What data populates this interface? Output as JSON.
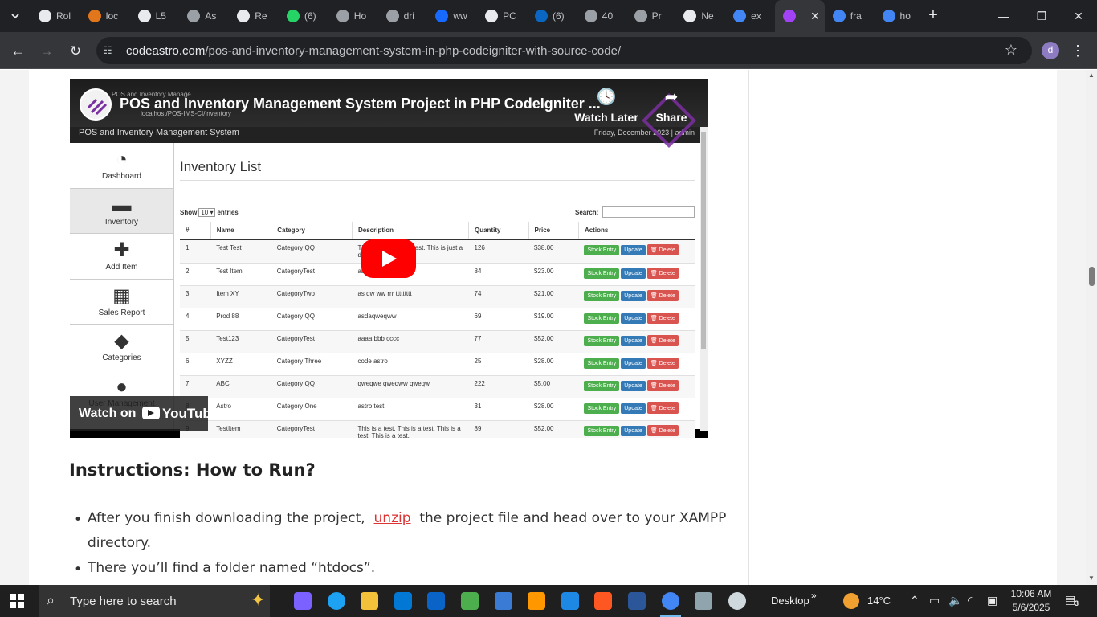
{
  "browser": {
    "tab_search_icon": "chevron-down-icon",
    "tabs": [
      {
        "label": "Rol",
        "fav_color": "#e8eaed"
      },
      {
        "label": "loc",
        "fav_color": "#e2761b"
      },
      {
        "label": "L5",
        "fav_color": "#e8eaed"
      },
      {
        "label": "As",
        "fav_color": "#9aa0a6"
      },
      {
        "label": "Re",
        "fav_color": "#e8eaed"
      },
      {
        "label": "(6)",
        "fav_color": "#25d366"
      },
      {
        "label": "Ho",
        "fav_color": "#9aa0a6"
      },
      {
        "label": "dri",
        "fav_color": "#9aa0a6"
      },
      {
        "label": "ww",
        "fav_color": "#1769ff"
      },
      {
        "label": "PC",
        "fav_color": "#e8eaed"
      },
      {
        "label": "(6)",
        "fav_color": "#0a66c2"
      },
      {
        "label": "40",
        "fav_color": "#9aa0a6"
      },
      {
        "label": "Pr",
        "fav_color": "#9aa0a6"
      },
      {
        "label": "Ne",
        "fav_color": "#e8eaed"
      },
      {
        "label": "ex",
        "fav_color": "#4285f4"
      },
      {
        "label": "",
        "fav_color": "#a142f4",
        "active": true
      },
      {
        "label": "fra",
        "fav_color": "#4285f4"
      },
      {
        "label": "ho",
        "fav_color": "#4285f4"
      }
    ],
    "active_tab_close": "✕",
    "new_tab": "+",
    "window_controls": {
      "minimize": "—",
      "maximize": "❐",
      "close": "✕"
    },
    "back": "←",
    "forward": "→",
    "reload": "↻",
    "url_host": "codeastro.com",
    "url_path": "/pos-and-inventory-management-system-in-php-codeigniter-with-source-code/",
    "bookmark_star": "☆",
    "profile_initial": "d",
    "menu": "⋮"
  },
  "video": {
    "title": "POS and Inventory Management System Project in PHP CodeIgniter ...",
    "inner_tab_text": "POS and Inventory Manage...",
    "inner_url": "localhost/POS-IMS-CI/inventory",
    "watch_later": "Watch Later",
    "share": "Share",
    "watch_on": "Watch on",
    "youtube": "YouTube",
    "app": {
      "name": "POS and Inventory Management System",
      "date": "Friday, December 2023 | admin",
      "menu": [
        {
          "label": "Dashboard",
          "icon": "◔"
        },
        {
          "label": "Inventory",
          "icon": "▬",
          "active": true
        },
        {
          "label": "Add Item",
          "icon": "✚"
        },
        {
          "label": "Sales Report",
          "icon": "▦"
        },
        {
          "label": "Categories",
          "icon": "◆"
        },
        {
          "label": "User Management",
          "icon": "●"
        }
      ],
      "page_title": "Inventory List",
      "show": "Show",
      "entries_value": "10 ▾",
      "entries": "entries",
      "search_label": "Search:",
      "columns": [
        "#",
        "Name",
        "Category",
        "Description",
        "Quantity",
        "Price",
        "Actions"
      ],
      "rows": [
        [
          "1",
          "Test Test",
          "Category QQ",
          "This is just a demo test. This is just a demo test.",
          "126",
          "$38.00"
        ],
        [
          "2",
          "Test Item",
          "CategoryTest",
          "ab",
          "84",
          "$23.00"
        ],
        [
          "3",
          "Item XY",
          "CategoryTwo",
          "as qw ww rrr ttttttttt",
          "74",
          "$21.00"
        ],
        [
          "4",
          "Prod 88",
          "Category QQ",
          "asdaqweqww",
          "69",
          "$19.00"
        ],
        [
          "5",
          "Test123",
          "CategoryTest",
          "aaaa bbb cccc",
          "77",
          "$52.00"
        ],
        [
          "6",
          "XYZZ",
          "Category Three",
          "code astro",
          "25",
          "$28.00"
        ],
        [
          "7",
          "ABC",
          "Category QQ",
          "qweqwe qweqww qweqw",
          "222",
          "$5.00"
        ],
        [
          "8",
          "Astro",
          "Category One",
          "astro test",
          "31",
          "$28.00"
        ],
        [
          "9",
          "TestItem",
          "CategoryTest",
          "This is a test. This is a test. This is a test. This is a test.",
          "89",
          "$52.00"
        ]
      ],
      "btn_stock": "Stock Entry",
      "btn_update": "Update",
      "btn_delete": "🗑 Delete"
    }
  },
  "article": {
    "heading": "Instructions: How to Run?",
    "bullet1_before": "After you finish downloading the project,",
    "bullet1_link": "unzip",
    "bullet1_after": "the project file and head over to your XAMPP",
    "bullet1_line2": "directory.",
    "bullet2": "There you’ll find a folder named “htdocs”."
  },
  "taskbar": {
    "search_placeholder": "Type here to search",
    "apps": [
      {
        "name": "copilot",
        "color": "#7b61ff"
      },
      {
        "name": "edge",
        "color": "#1da1f2"
      },
      {
        "name": "file-explorer",
        "color": "#f3c13a"
      },
      {
        "name": "store",
        "color": "#0078d4"
      },
      {
        "name": "outlook",
        "color": "#0a64c8"
      },
      {
        "name": "utorrent",
        "color": "#4cae4c"
      },
      {
        "name": "calculator-app",
        "color": "#3a7bd5"
      },
      {
        "name": "sublime",
        "color": "#ff9800"
      },
      {
        "name": "media-player",
        "color": "#1e88e5"
      },
      {
        "name": "paint",
        "color": "#ff5722"
      },
      {
        "name": "word",
        "color": "#2b579a"
      },
      {
        "name": "chrome",
        "color": "#4285f4",
        "active": true
      },
      {
        "name": "photos",
        "color": "#90a4ae"
      },
      {
        "name": "settings",
        "color": "#cfd8dc"
      }
    ],
    "desktop": "Desktop",
    "chevrons": "»",
    "temperature": "14°C",
    "time": "10:06 AM",
    "date": "5/6/2025",
    "notifications": "3"
  }
}
